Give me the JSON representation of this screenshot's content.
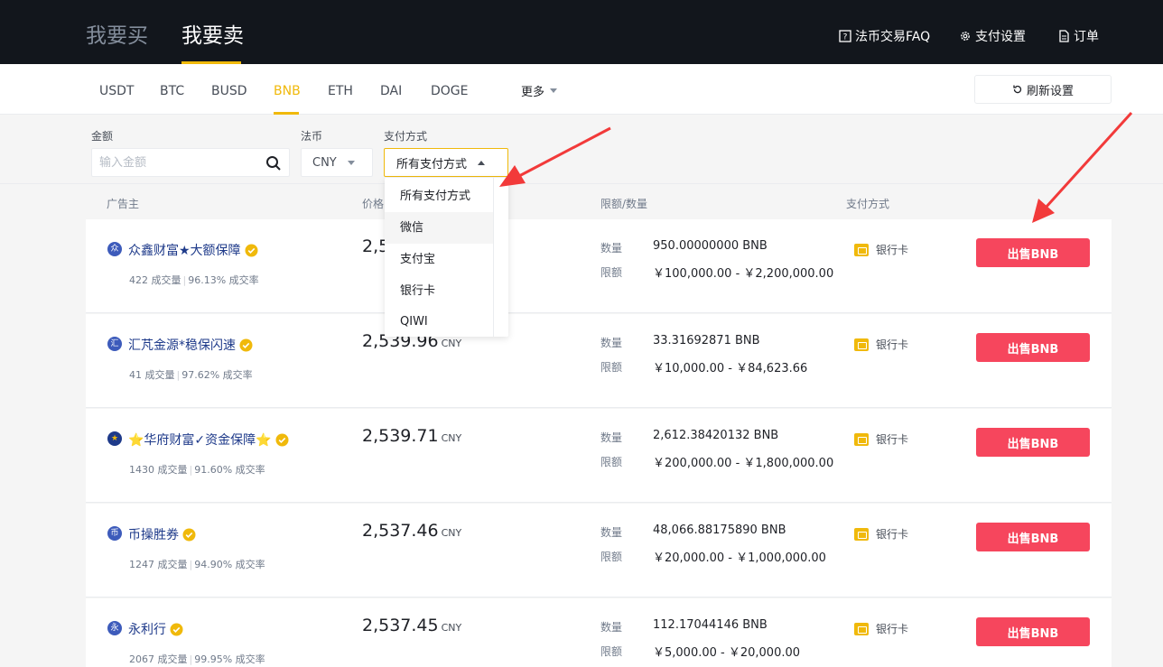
{
  "header": {
    "buy_tab": "我要买",
    "sell_tab": "我要卖",
    "faq": "法币交易FAQ",
    "payment_settings": "支付设置",
    "orders": "订单"
  },
  "coins": [
    "USDT",
    "BTC",
    "BUSD",
    "BNB",
    "ETH",
    "DAI",
    "DOGE"
  ],
  "active_coin": "BNB",
  "more_label": "更多",
  "refresh_label": "刷新设置",
  "filters": {
    "amount_label": "金额",
    "amount_placeholder": "输入金额",
    "fiat_label": "法币",
    "fiat_value": "CNY",
    "payment_label": "支付方式",
    "payment_value": "所有支付方式"
  },
  "dropdown_options": [
    "所有支付方式",
    "微信",
    "支付宝",
    "银行卡",
    "QIWI"
  ],
  "columns": {
    "advertiser": "广告主",
    "price": "价格",
    "limit": "限额/数量",
    "payment": "支付方式"
  },
  "rows": [
    {
      "avatar": "众",
      "name": "众鑫财富★大额保障",
      "trades": "422",
      "trades_label": "成交量",
      "rate": "96.13%",
      "rate_label": "成交率",
      "price": "2,5",
      "unit": "",
      "qty_label": "数量",
      "qty": "950.00000000 BNB",
      "limit_label": "限额",
      "limit": "￥100,000.00 - ￥2,200,000.00",
      "pay": "银行卡",
      "button": "出售BNB"
    },
    {
      "avatar": "汇",
      "name": "汇芃金源*稳保闪速",
      "trades": "41",
      "trades_label": "成交量",
      "rate": "97.62%",
      "rate_label": "成交率",
      "price": "2,539.96",
      "unit": "CNY",
      "qty_label": "数量",
      "qty": "33.31692871 BNB",
      "limit_label": "限额",
      "limit": "￥10,000.00 - ￥84,623.66",
      "pay": "银行卡",
      "button": "出售BNB"
    },
    {
      "avatar": "★",
      "name": "⭐华府财富✓资金保障⭐",
      "trades": "1430",
      "trades_label": "成交量",
      "rate": "91.60%",
      "rate_label": "成交率",
      "price": "2,539.71",
      "unit": "CNY",
      "qty_label": "数量",
      "qty": "2,612.38420132 BNB",
      "limit_label": "限额",
      "limit": "￥200,000.00 - ￥1,800,000.00",
      "pay": "银行卡",
      "button": "出售BNB"
    },
    {
      "avatar": "币",
      "name": "币操胜券",
      "trades": "1247",
      "trades_label": "成交量",
      "rate": "94.90%",
      "rate_label": "成交率",
      "price": "2,537.46",
      "unit": "CNY",
      "qty_label": "数量",
      "qty": "48,066.88175890 BNB",
      "limit_label": "限额",
      "limit": "￥20,000.00 - ￥1,000,000.00",
      "pay": "银行卡",
      "button": "出售BNB"
    },
    {
      "avatar": "永",
      "name": "永利行",
      "trades": "2067",
      "trades_label": "成交量",
      "rate": "99.95%",
      "rate_label": "成交率",
      "price": "2,537.45",
      "unit": "CNY",
      "qty_label": "数量",
      "qty": "112.17044146 BNB",
      "limit_label": "限额",
      "limit": "￥5,000.00 - ￥20,000.00",
      "pay": "银行卡",
      "button": "出售BNB"
    }
  ],
  "colors": {
    "accent": "#f0b90b",
    "sell": "#f6465d",
    "header_bg": "#12161c",
    "arrow": "#f23a3a"
  }
}
